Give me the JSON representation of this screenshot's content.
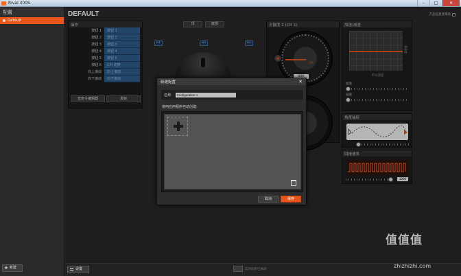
{
  "window": {
    "title": "Rival 300S",
    "min": "–",
    "max": "□",
    "close": "✕"
  },
  "sidebar": {
    "header": "配置",
    "configs": [
      {
        "label": "Default"
      }
    ],
    "new_button": "新建"
  },
  "main": {
    "config_title": "DEFAULT",
    "top_link": "产品信息及帮助"
  },
  "actions": {
    "header": "操作",
    "rows": [
      {
        "key": "按钮 1",
        "value": "按钮 1"
      },
      {
        "key": "按钮 2",
        "value": "按钮 2"
      },
      {
        "key": "按钮 3",
        "value": "按钮 3"
      },
      {
        "key": "按钮 4",
        "value": "按钮 4"
      },
      {
        "key": "按钮 5",
        "value": "按钮 5"
      },
      {
        "key": "按钮 6",
        "value": "CPI 切换"
      },
      {
        "key": "向上滚动",
        "value": "向上滚动"
      },
      {
        "key": "向下滚动",
        "value": "向下滚动"
      }
    ],
    "macro_button": "宏命令编辑器",
    "launch_button": "发射"
  },
  "view_toggle": {
    "top": "顶",
    "bottom": "底部"
  },
  "button_marks": [
    "B1",
    "B3",
    "B2"
  ],
  "sensitivity": {
    "header": "灵敏度 1 (CPI 1)",
    "gauge_label": "CPI",
    "value": "800"
  },
  "accel": {
    "header": "加速/减速",
    "side_label": "满速度",
    "bottom_label": "不同速度",
    "accel_label": "加速",
    "decel_label": "减速"
  },
  "angle": {
    "header": "角度捕捉"
  },
  "polling": {
    "header": "回报速率",
    "value": "1000"
  },
  "dialog": {
    "title": "新建配置",
    "close": "✕",
    "name_label": "名称:",
    "name_value": "Configuration 1",
    "apps_label": "使用应用程序自动创建:",
    "cancel": "取消",
    "save": "保存"
  },
  "footer": {
    "settings": "设置",
    "sync_label": "实时同步已关闭"
  },
  "watermark": {
    "main": "值值值",
    "domain": "zhizhizhi.com"
  },
  "colors": {
    "accent": "#e8561a",
    "button_blue": "#2e5d8e",
    "bg": "#262626"
  }
}
